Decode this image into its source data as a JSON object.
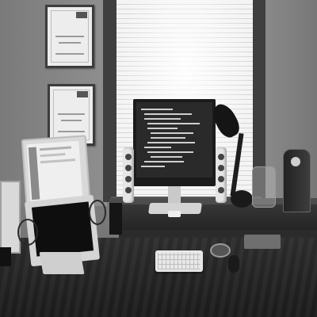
{
  "scene": {
    "description_hidden": "",
    "objects": [
      "window-blinds",
      "desktop-monitor",
      "speaker-left",
      "speaker-right",
      "desk-lamp",
      "laptop",
      "keyboard",
      "mouse",
      "certificate-upper",
      "certificate-lower",
      "award-plaque",
      "desk-shelf"
    ]
  },
  "colors": {
    "desk": "#262626",
    "wall": "#848484",
    "blinds": "#f0f0f0"
  }
}
